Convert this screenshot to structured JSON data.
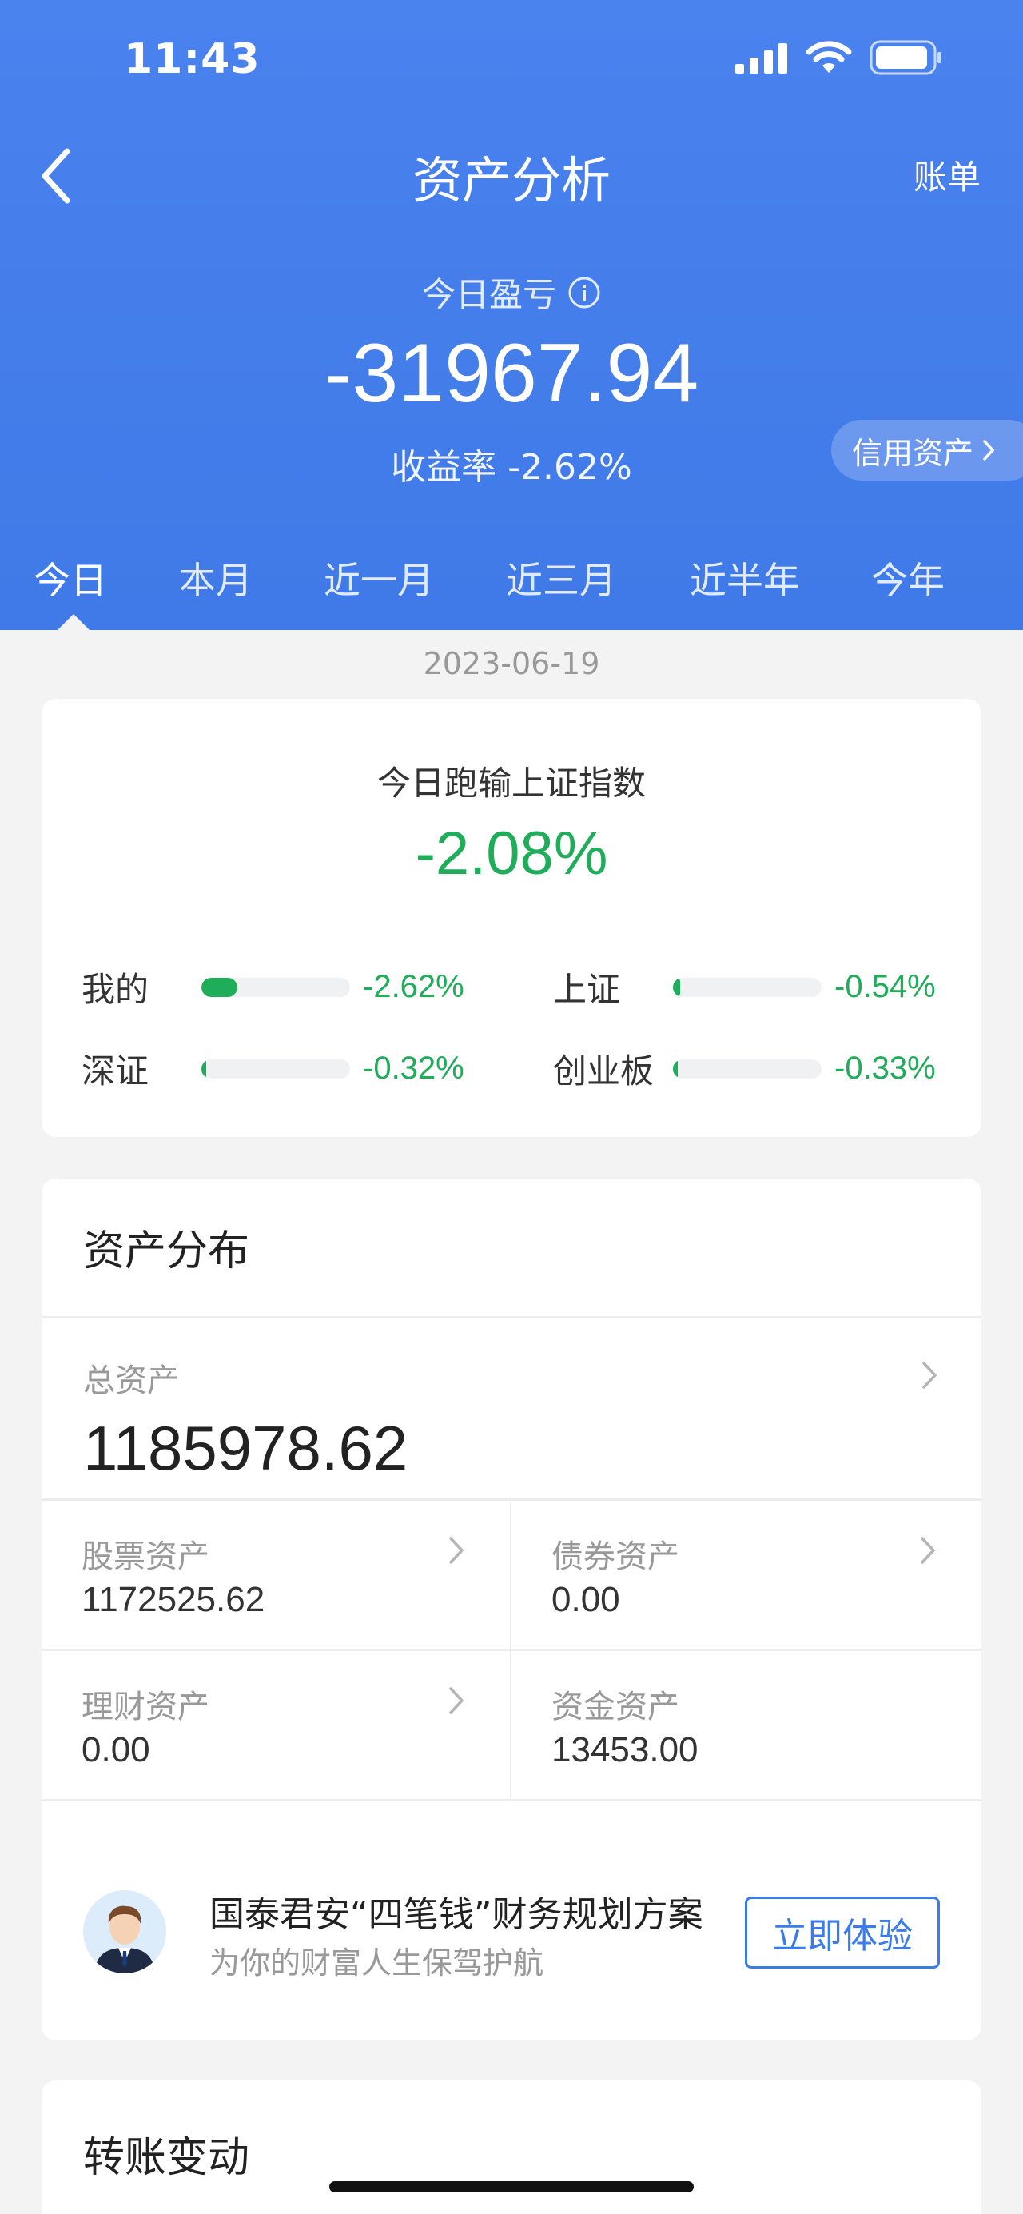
{
  "status_bar": {
    "time": "11:43"
  },
  "nav": {
    "title": "资产分析",
    "right": "账单"
  },
  "summary": {
    "pnl_label": "今日盈亏",
    "pnl_value": "-31967.94",
    "rate_text": "收益率 -2.62%",
    "credit_label": "信用资产"
  },
  "tabs": [
    {
      "label": "今日",
      "active": true
    },
    {
      "label": "本月"
    },
    {
      "label": "近一月"
    },
    {
      "label": "近三月"
    },
    {
      "label": "近半年"
    },
    {
      "label": "今年"
    }
  ],
  "date": "2023-06-19",
  "compare": {
    "title": "今日跑输上证指数",
    "value": "-2.08%",
    "items": [
      {
        "label": "我的",
        "value": "-2.62%",
        "fill": 0.24
      },
      {
        "label": "上证",
        "value": "-0.54%",
        "fill": 0.05
      },
      {
        "label": "深证",
        "value": "-0.32%",
        "fill": 0.03
      },
      {
        "label": "创业板",
        "value": "-0.33%",
        "fill": 0.03
      }
    ]
  },
  "distribution": {
    "title": "资产分布",
    "total_label": "总资产",
    "total_value": "1185978.62",
    "cells": [
      {
        "label": "股票资产",
        "value": "1172525.62"
      },
      {
        "label": "债券资产",
        "value": "0.00"
      },
      {
        "label": "理财资产",
        "value": "0.00"
      },
      {
        "label": "资金资产",
        "value": "13453.00"
      }
    ]
  },
  "promo": {
    "title": "国泰君安“四笔钱”财务规划方案",
    "subtitle": "为你的财富人生保驾护航",
    "button": "立即体验"
  },
  "transfer": {
    "title": "转账变动"
  },
  "colors": {
    "header_blue": "#4a82ee",
    "loss_green": "#1fad5a",
    "accent_blue": "#3a7ce9"
  }
}
